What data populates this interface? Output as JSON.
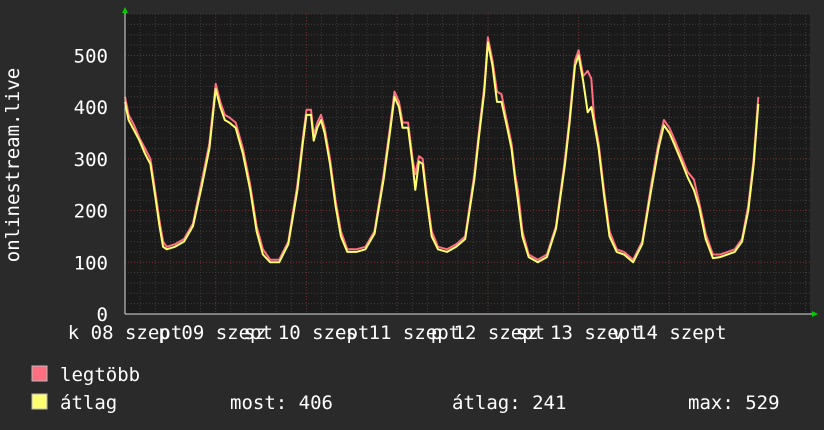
{
  "chart_data": {
    "type": "line",
    "ylabel": "onlinestream.live",
    "ylim": [
      0,
      580
    ],
    "yticks": [
      0,
      100,
      200,
      300,
      400,
      500
    ],
    "xlim": [
      0,
      7.55
    ],
    "xticks": [
      {
        "x": 0.0,
        "label": "k 08 szept"
      },
      {
        "x": 1.0,
        "label": "p 09 szept"
      },
      {
        "x": 2.0,
        "label": "sz 10 szept"
      },
      {
        "x": 3.0,
        "label": "cs 11 szept"
      },
      {
        "x": 4.0,
        "label": "p 12 szept"
      },
      {
        "x": 5.0,
        "label": "sz 13 szept"
      },
      {
        "x": 6.0,
        "label": "v 14 szept"
      }
    ],
    "grid": true,
    "series": [
      {
        "name": "legtöbb",
        "color": "#ff6f7f",
        "points": [
          [
            0.0,
            420
          ],
          [
            0.04,
            385
          ],
          [
            0.1,
            365
          ],
          [
            0.16,
            340
          ],
          [
            0.22,
            320
          ],
          [
            0.28,
            300
          ],
          [
            0.34,
            230
          ],
          [
            0.38,
            180
          ],
          [
            0.42,
            140
          ],
          [
            0.46,
            130
          ],
          [
            0.55,
            135
          ],
          [
            0.65,
            145
          ],
          [
            0.75,
            175
          ],
          [
            0.85,
            260
          ],
          [
            0.93,
            330
          ],
          [
            1.0,
            445
          ],
          [
            1.05,
            410
          ],
          [
            1.1,
            385
          ],
          [
            1.15,
            380
          ],
          [
            1.22,
            370
          ],
          [
            1.3,
            320
          ],
          [
            1.38,
            250
          ],
          [
            1.45,
            170
          ],
          [
            1.52,
            125
          ],
          [
            1.6,
            105
          ],
          [
            1.7,
            105
          ],
          [
            1.8,
            140
          ],
          [
            1.9,
            250
          ],
          [
            1.96,
            340
          ],
          [
            2.0,
            395
          ],
          [
            2.05,
            395
          ],
          [
            2.08,
            345
          ],
          [
            2.12,
            370
          ],
          [
            2.16,
            385
          ],
          [
            2.2,
            360
          ],
          [
            2.26,
            300
          ],
          [
            2.32,
            220
          ],
          [
            2.38,
            160
          ],
          [
            2.45,
            125
          ],
          [
            2.55,
            125
          ],
          [
            2.65,
            130
          ],
          [
            2.75,
            160
          ],
          [
            2.85,
            270
          ],
          [
            2.92,
            360
          ],
          [
            2.97,
            430
          ],
          [
            3.02,
            410
          ],
          [
            3.06,
            370
          ],
          [
            3.12,
            370
          ],
          [
            3.17,
            300
          ],
          [
            3.2,
            270
          ],
          [
            3.24,
            305
          ],
          [
            3.28,
            300
          ],
          [
            3.32,
            240
          ],
          [
            3.38,
            160
          ],
          [
            3.45,
            130
          ],
          [
            3.55,
            125
          ],
          [
            3.65,
            135
          ],
          [
            3.75,
            150
          ],
          [
            3.85,
            270
          ],
          [
            3.9,
            350
          ],
          [
            3.96,
            440
          ],
          [
            4.0,
            535
          ],
          [
            4.05,
            490
          ],
          [
            4.1,
            430
          ],
          [
            4.15,
            425
          ],
          [
            4.2,
            380
          ],
          [
            4.26,
            330
          ],
          [
            4.3,
            270
          ],
          [
            4.33,
            240
          ],
          [
            4.38,
            160
          ],
          [
            4.45,
            115
          ],
          [
            4.55,
            105
          ],
          [
            4.65,
            115
          ],
          [
            4.75,
            170
          ],
          [
            4.85,
            300
          ],
          [
            4.9,
            380
          ],
          [
            4.96,
            490
          ],
          [
            5.0,
            510
          ],
          [
            5.05,
            460
          ],
          [
            5.1,
            470
          ],
          [
            5.14,
            455
          ],
          [
            5.17,
            380
          ],
          [
            5.22,
            330
          ],
          [
            5.28,
            240
          ],
          [
            5.34,
            160
          ],
          [
            5.42,
            125
          ],
          [
            5.5,
            120
          ],
          [
            5.6,
            105
          ],
          [
            5.7,
            140
          ],
          [
            5.8,
            250
          ],
          [
            5.88,
            330
          ],
          [
            5.94,
            375
          ],
          [
            6.0,
            360
          ],
          [
            6.05,
            340
          ],
          [
            6.12,
            310
          ],
          [
            6.2,
            275
          ],
          [
            6.27,
            260
          ],
          [
            6.33,
            215
          ],
          [
            6.4,
            155
          ],
          [
            6.48,
            115
          ],
          [
            6.56,
            115
          ],
          [
            6.64,
            120
          ],
          [
            6.72,
            125
          ],
          [
            6.8,
            145
          ],
          [
            6.87,
            210
          ],
          [
            6.93,
            300
          ],
          [
            6.98,
            420
          ]
        ]
      },
      {
        "name": "átlag",
        "color": "#ffff70",
        "points": [
          [
            0.0,
            410
          ],
          [
            0.04,
            375
          ],
          [
            0.1,
            355
          ],
          [
            0.16,
            335
          ],
          [
            0.22,
            310
          ],
          [
            0.28,
            290
          ],
          [
            0.34,
            220
          ],
          [
            0.38,
            170
          ],
          [
            0.42,
            130
          ],
          [
            0.46,
            125
          ],
          [
            0.55,
            130
          ],
          [
            0.65,
            140
          ],
          [
            0.75,
            170
          ],
          [
            0.85,
            250
          ],
          [
            0.93,
            320
          ],
          [
            1.0,
            435
          ],
          [
            1.05,
            400
          ],
          [
            1.1,
            375
          ],
          [
            1.15,
            370
          ],
          [
            1.22,
            360
          ],
          [
            1.3,
            310
          ],
          [
            1.38,
            240
          ],
          [
            1.45,
            160
          ],
          [
            1.52,
            115
          ],
          [
            1.6,
            100
          ],
          [
            1.7,
            100
          ],
          [
            1.8,
            135
          ],
          [
            1.9,
            240
          ],
          [
            1.96,
            330
          ],
          [
            2.0,
            385
          ],
          [
            2.05,
            385
          ],
          [
            2.08,
            335
          ],
          [
            2.12,
            360
          ],
          [
            2.16,
            375
          ],
          [
            2.2,
            350
          ],
          [
            2.26,
            290
          ],
          [
            2.32,
            210
          ],
          [
            2.38,
            150
          ],
          [
            2.45,
            120
          ],
          [
            2.55,
            120
          ],
          [
            2.65,
            125
          ],
          [
            2.75,
            155
          ],
          [
            2.85,
            260
          ],
          [
            2.92,
            350
          ],
          [
            2.97,
            420
          ],
          [
            3.02,
            400
          ],
          [
            3.06,
            360
          ],
          [
            3.12,
            360
          ],
          [
            3.17,
            290
          ],
          [
            3.2,
            240
          ],
          [
            3.24,
            295
          ],
          [
            3.28,
            290
          ],
          [
            3.32,
            230
          ],
          [
            3.38,
            150
          ],
          [
            3.45,
            125
          ],
          [
            3.55,
            120
          ],
          [
            3.65,
            130
          ],
          [
            3.75,
            145
          ],
          [
            3.85,
            260
          ],
          [
            3.9,
            340
          ],
          [
            3.96,
            430
          ],
          [
            4.0,
            525
          ],
          [
            4.05,
            480
          ],
          [
            4.1,
            410
          ],
          [
            4.15,
            410
          ],
          [
            4.2,
            370
          ],
          [
            4.26,
            320
          ],
          [
            4.3,
            260
          ],
          [
            4.33,
            220
          ],
          [
            4.38,
            150
          ],
          [
            4.45,
            110
          ],
          [
            4.55,
            100
          ],
          [
            4.65,
            110
          ],
          [
            4.75,
            165
          ],
          [
            4.85,
            290
          ],
          [
            4.9,
            370
          ],
          [
            4.96,
            480
          ],
          [
            5.0,
            500
          ],
          [
            5.05,
            450
          ],
          [
            5.1,
            390
          ],
          [
            5.14,
            400
          ],
          [
            5.17,
            370
          ],
          [
            5.22,
            320
          ],
          [
            5.28,
            230
          ],
          [
            5.34,
            150
          ],
          [
            5.42,
            120
          ],
          [
            5.5,
            115
          ],
          [
            5.6,
            100
          ],
          [
            5.7,
            135
          ],
          [
            5.8,
            240
          ],
          [
            5.88,
            320
          ],
          [
            5.94,
            365
          ],
          [
            6.0,
            350
          ],
          [
            6.05,
            330
          ],
          [
            6.12,
            300
          ],
          [
            6.2,
            265
          ],
          [
            6.27,
            240
          ],
          [
            6.33,
            205
          ],
          [
            6.4,
            145
          ],
          [
            6.48,
            108
          ],
          [
            6.56,
            110
          ],
          [
            6.64,
            115
          ],
          [
            6.72,
            120
          ],
          [
            6.8,
            140
          ],
          [
            6.87,
            200
          ],
          [
            6.93,
            290
          ],
          [
            6.98,
            406
          ]
        ]
      }
    ]
  },
  "legend": {
    "items": [
      {
        "label": "legtöbb",
        "color": "#ff6f7f"
      },
      {
        "label": "átlag",
        "color": "#ffff70"
      }
    ]
  },
  "stats": {
    "current": "most: 406",
    "average": "átlag: 241",
    "max": "max: 529"
  }
}
